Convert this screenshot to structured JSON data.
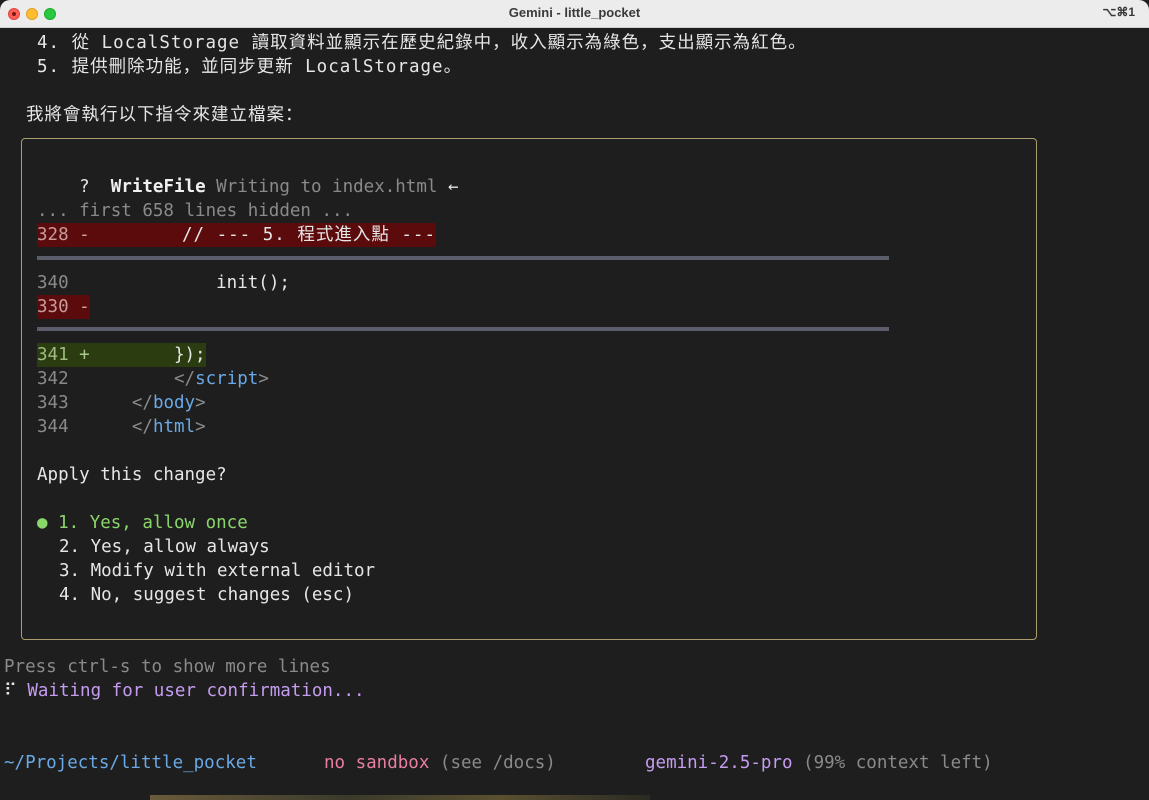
{
  "window": {
    "title": "Gemini - little_pocket",
    "shortcut": "⌥⌘1"
  },
  "output": {
    "step4": "4. 從 LocalStorage 讀取資料並顯示在歷史紀錄中，收入顯示為綠色，支出顯示為紅色。",
    "step5": "5. 提供刪除功能，並同步更新 LocalStorage。",
    "intro": "我將會執行以下指令來建立檔案："
  },
  "tool": {
    "status_glyph": "?",
    "name": "WriteFile",
    "description": "Writing to index.html",
    "arrow": "←"
  },
  "diff": {
    "hidden_note": "... first 658 lines hidden ...",
    "lines": [
      {
        "num": "328",
        "sign": "-",
        "code": "        // --- 5. 程式進入點 ---"
      },
      {
        "num": "340",
        "sign": " ",
        "code": "            init();"
      },
      {
        "num": "330",
        "sign": "-",
        "code": ""
      },
      {
        "num": "341",
        "sign": "+",
        "code": "        });"
      },
      {
        "num": "342",
        "sign": " ",
        "code_indent": "    ",
        "tag_open": "</",
        "tag_name": "script",
        "tag_close": ">"
      },
      {
        "num": "343",
        "sign": " ",
        "code_indent": "",
        "tag_open": "</",
        "tag_name": "body",
        "tag_close": ">"
      },
      {
        "num": "344",
        "sign": " ",
        "code_indent": "",
        "tag_open": "</",
        "tag_name": "html",
        "tag_close": ">"
      }
    ]
  },
  "prompt": {
    "question": "Apply this change?",
    "selected_marker": "●",
    "options": [
      "1. Yes, allow once",
      "2. Yes, allow always",
      "3. Modify with external editor",
      "4. No, suggest changes (esc)"
    ]
  },
  "footer": {
    "hint": "Press ctrl-s to show more lines",
    "spinner": "⠏",
    "waiting": "Waiting for user confirmation...",
    "cwd": "~/Projects/little_pocket",
    "sandbox": "no sandbox",
    "sandbox_note": "(see /docs)",
    "model": "gemini-2.5-pro",
    "context": "(99% context left)"
  },
  "colors": {
    "background": "#1e1e1e",
    "border": "#a99d6b",
    "deleted_bg": "#5b0b0b",
    "added_bg": "#2b3d10",
    "tag": "#6aa9e6",
    "accent_green": "#8bd66b",
    "accent_purple": "#c59cf0",
    "accent_pink": "#e97ea0"
  }
}
